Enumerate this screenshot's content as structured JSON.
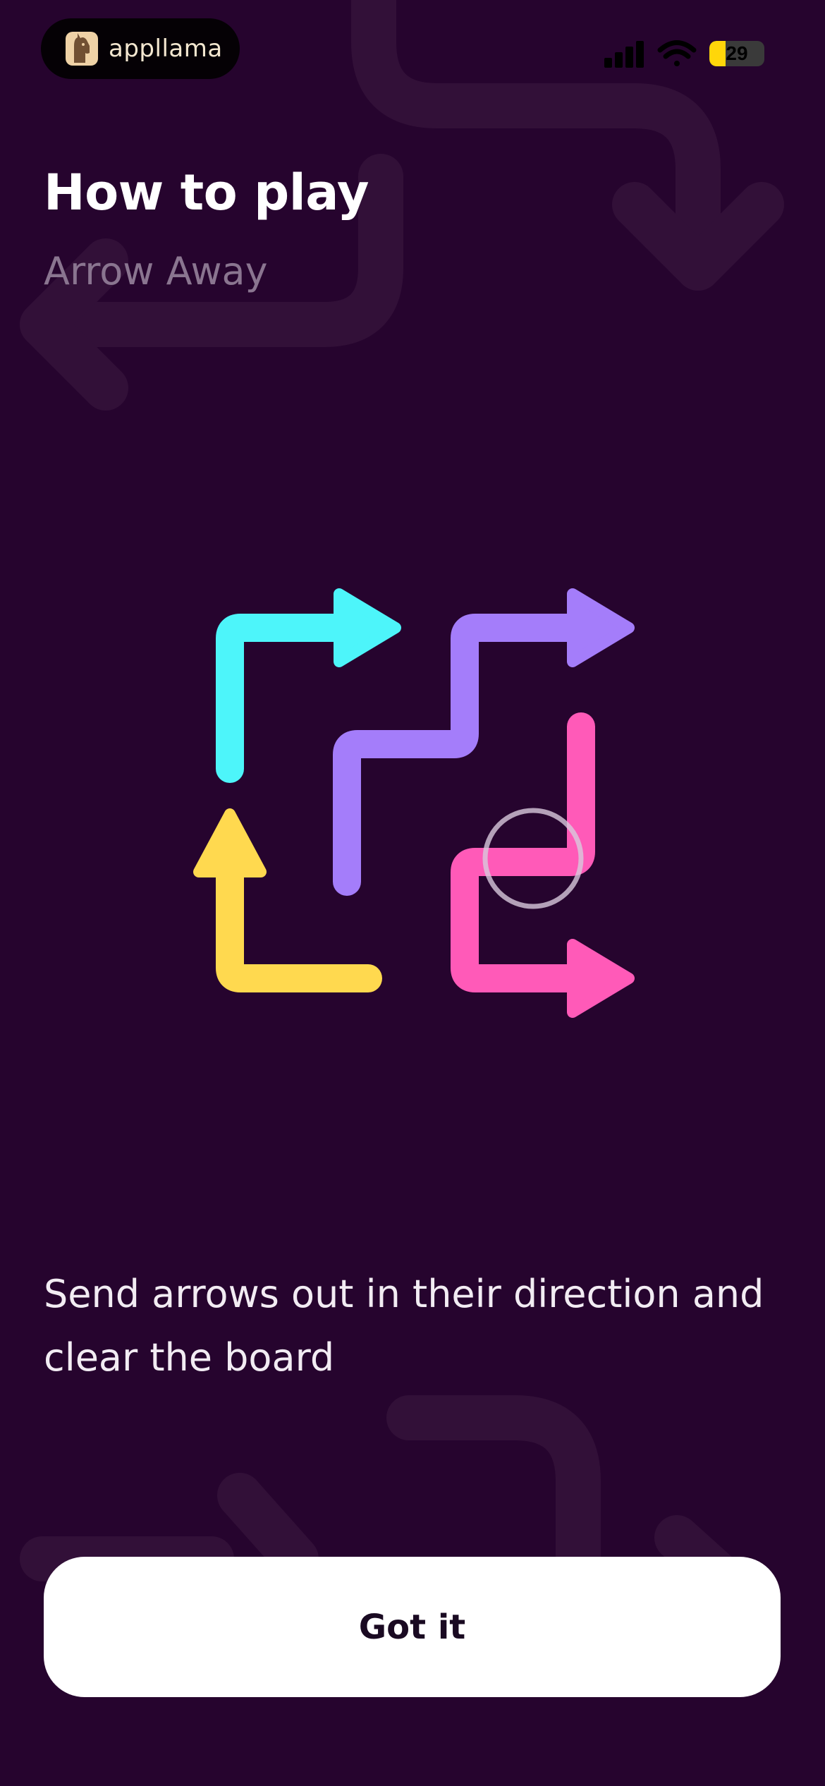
{
  "status_bar": {
    "brand_name": "appllama",
    "brand_icon": "llama-logo-icon",
    "signal_icon": "cellular-signal-icon",
    "wifi_icon": "wifi-icon",
    "battery_percent": "29",
    "battery_level": 0.29,
    "battery_color": "#ffd60a"
  },
  "header": {
    "title": "How to play",
    "subtitle": "Arrow Away"
  },
  "tutorial": {
    "illustration": "arrow-puzzle-board",
    "tap_indicator": "tap-circle-icon",
    "arrows": [
      {
        "color": "#4df5fa",
        "direction": "right"
      },
      {
        "color": "#a47dfa",
        "direction": "right"
      },
      {
        "color": "#ffd94f",
        "direction": "up"
      },
      {
        "color": "#ff5ab8",
        "direction": "right"
      }
    ],
    "instruction": "Send arrows out in their direction and clear the board"
  },
  "actions": {
    "primary_label": "Got it"
  },
  "theme": {
    "background": "#26042e",
    "button_background": "#ffffff"
  }
}
